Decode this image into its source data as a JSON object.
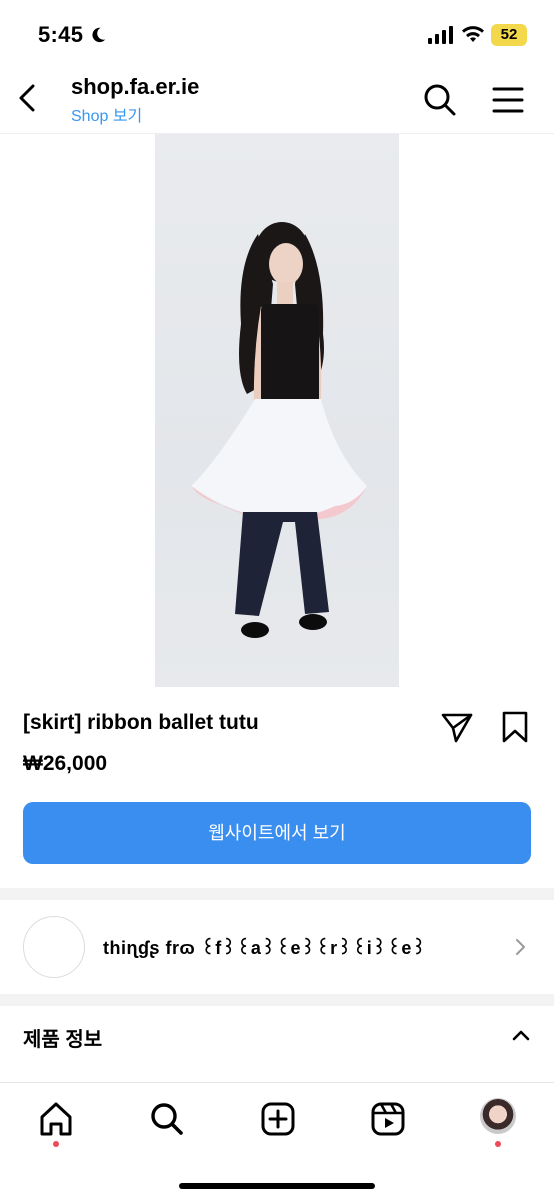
{
  "status": {
    "time": "5:45",
    "battery": "52"
  },
  "header": {
    "title": "shop.fa.er.ie",
    "subtitle": "Shop 보기"
  },
  "product": {
    "title": "[skirt] ribbon ballet tutu",
    "price": "₩26,000",
    "website_button": "웹사이트에서 보기"
  },
  "shop": {
    "name": "thiɳɠʂ frɷ ꒰f꒱꒰a꒱꒰e꒱꒰r꒱꒰i꒱꒰e꒱"
  },
  "details": {
    "title": "제품 정보"
  },
  "colors": {
    "accent": "#3a8ef0",
    "link": "#3897f0",
    "notification": "#ed4956"
  },
  "icons": [
    "moon-icon",
    "signal-icon",
    "wifi-icon",
    "back-arrow-icon",
    "search-icon",
    "hamburger-menu-icon",
    "share-paper-plane-icon",
    "bookmark-icon",
    "chevron-right-icon",
    "chevron-up-icon",
    "home-icon",
    "explore-search-icon",
    "create-plus-icon",
    "reels-icon",
    "profile-avatar"
  ]
}
